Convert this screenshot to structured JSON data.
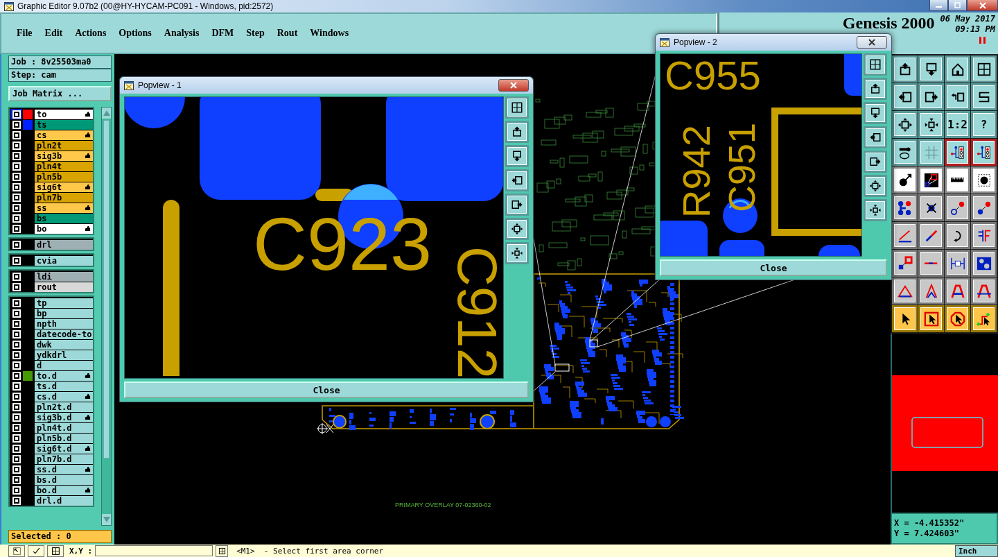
{
  "window": {
    "title": "Graphic Editor 9.07b2 (00@HY-HYCAM-PC091 - Windows, pid:2572)"
  },
  "menu": [
    {
      "label": "File"
    },
    {
      "label": "Edit"
    },
    {
      "label": "Actions"
    },
    {
      "label": "Options"
    },
    {
      "label": "Analysis"
    },
    {
      "label": "DFM"
    },
    {
      "label": "Step"
    },
    {
      "label": "Rout"
    },
    {
      "label": "Windows"
    }
  ],
  "brand": {
    "product": "Genesis 2000",
    "date": "06 May 2017",
    "time": "09:13 PM"
  },
  "job": {
    "job": "Job : 8v25503ma0",
    "step": "Step: cam",
    "matrix_button": "Job Matrix ..."
  },
  "layer_groups": [
    {
      "layers": [
        {
          "name": "to",
          "kind": "silk",
          "color": "#ff0000",
          "marked": true,
          "affected": true
        },
        {
          "name": "ts",
          "kind": "mask",
          "color": "#0022ff",
          "marked": false,
          "affected": false
        },
        {
          "name": "cs",
          "kind": "signal",
          "marked": true,
          "affected": false
        },
        {
          "name": "pln2t",
          "kind": "plane",
          "marked": false,
          "affected": false
        },
        {
          "name": "sig3b",
          "kind": "signal",
          "marked": true,
          "affected": false
        },
        {
          "name": "pln4t",
          "kind": "plane",
          "marked": false,
          "affected": false
        },
        {
          "name": "pln5b",
          "kind": "plane",
          "marked": false,
          "affected": false
        },
        {
          "name": "sig6t",
          "kind": "signal",
          "marked": true,
          "affected": false
        },
        {
          "name": "pln7b",
          "kind": "plane",
          "marked": false,
          "affected": false
        },
        {
          "name": "ss",
          "kind": "signal",
          "marked": true,
          "affected": false
        },
        {
          "name": "bs",
          "kind": "mask",
          "marked": false,
          "affected": false
        },
        {
          "name": "bo",
          "kind": "silk",
          "marked": true,
          "affected": false
        }
      ]
    },
    {
      "layers": [
        {
          "name": "drl",
          "kind": "drill",
          "marked": false,
          "affected": false
        }
      ]
    },
    {
      "layers": [
        {
          "name": "cvia",
          "kind": "misc",
          "marked": false,
          "affected": false
        }
      ]
    },
    {
      "layers": [
        {
          "name": "ldi",
          "kind": "drill",
          "marked": false,
          "affected": false
        },
        {
          "name": "rout",
          "kind": "rout",
          "marked": false,
          "affected": false
        }
      ]
    },
    {
      "layers": [
        {
          "name": "tp",
          "kind": "misc",
          "marked": false,
          "affected": false
        },
        {
          "name": "bp",
          "kind": "misc",
          "marked": false,
          "affected": false
        },
        {
          "name": "npth",
          "kind": "misc",
          "marked": false,
          "affected": false
        },
        {
          "name": "datecode-to",
          "kind": "misc",
          "marked": false,
          "affected": false
        },
        {
          "name": "dwk",
          "kind": "misc",
          "marked": false,
          "affected": false
        },
        {
          "name": "ydkdrl",
          "kind": "misc",
          "marked": false,
          "affected": false
        },
        {
          "name": "d",
          "kind": "misc",
          "marked": false,
          "affected": false
        },
        {
          "name": "to.d",
          "kind": "misc",
          "color": "#449900",
          "marked": true,
          "affected": false
        },
        {
          "name": "ts.d",
          "kind": "misc",
          "marked": false,
          "affected": false
        },
        {
          "name": "cs.d",
          "kind": "misc",
          "marked": true,
          "affected": false
        },
        {
          "name": "pln2t.d",
          "kind": "misc",
          "marked": false,
          "affected": false
        },
        {
          "name": "sig3b.d",
          "kind": "misc",
          "marked": true,
          "affected": false
        },
        {
          "name": "pln4t.d",
          "kind": "misc",
          "marked": false,
          "affected": false
        },
        {
          "name": "pln5b.d",
          "kind": "misc",
          "marked": false,
          "affected": false
        },
        {
          "name": "sig6t.d",
          "kind": "misc",
          "marked": true,
          "affected": false
        },
        {
          "name": "pln7b.d",
          "kind": "misc",
          "marked": false,
          "affected": false
        },
        {
          "name": "ss.d",
          "kind": "misc",
          "marked": true,
          "affected": false
        },
        {
          "name": "bs.d",
          "kind": "misc",
          "marked": false,
          "affected": false
        },
        {
          "name": "bo.d",
          "kind": "misc",
          "marked": true,
          "affected": false
        },
        {
          "name": "drl.d",
          "kind": "misc",
          "marked": false,
          "affected": false
        }
      ]
    }
  ],
  "selected_count": "Selected : 0",
  "canvas": {
    "overlay_label": "PRIMARY OVERLAY 07-02360-02"
  },
  "popviews": [
    {
      "title": "Popview - 1",
      "active": true,
      "labels": [
        {
          "text": "C923",
          "kind": "horizontal"
        },
        {
          "text": "C912",
          "kind": "down"
        }
      ],
      "close": "Close"
    },
    {
      "title": "Popview - 2",
      "active": false,
      "labels": [
        {
          "text": "C955",
          "kind": "horizontal"
        },
        {
          "text": "R942",
          "kind": "up"
        },
        {
          "text": "C951",
          "kind": "up"
        }
      ],
      "close": "Close"
    }
  ],
  "tools": [
    {
      "kind": "export-up"
    },
    {
      "kind": "export-down"
    },
    {
      "kind": "home"
    },
    {
      "kind": "panes"
    },
    {
      "kind": "box-left"
    },
    {
      "kind": "box-right"
    },
    {
      "kind": "undo"
    },
    {
      "kind": "zigzag"
    },
    {
      "kind": "fit"
    },
    {
      "kind": "center"
    },
    {
      "kind": "ratio",
      "label": "1:2"
    },
    {
      "kind": "help",
      "label": "?"
    },
    {
      "kind": "settings"
    },
    {
      "kind": "grid"
    },
    {
      "kind": "circuit"
    },
    {
      "kind": "circuit"
    },
    {
      "kind": "pad-arrow"
    },
    {
      "kind": "snap"
    },
    {
      "kind": "ruler"
    },
    {
      "kind": "pad"
    },
    {
      "kind": "nodes"
    },
    {
      "kind": "cross"
    },
    {
      "kind": "pad-link"
    },
    {
      "kind": "pad-link-blue"
    },
    {
      "kind": "slash"
    },
    {
      "kind": "slash-blue"
    },
    {
      "kind": "curve"
    },
    {
      "kind": "split"
    },
    {
      "kind": "pad-box"
    },
    {
      "kind": "line"
    },
    {
      "kind": "measure"
    },
    {
      "kind": "blobs"
    },
    {
      "kind": "triangle"
    },
    {
      "kind": "peak"
    },
    {
      "kind": "arch"
    },
    {
      "kind": "arch-cross"
    },
    {
      "kind": "pointer"
    },
    {
      "kind": "pointer-box"
    },
    {
      "kind": "pointer-oct"
    },
    {
      "kind": "pointer-route"
    }
  ],
  "coords": {
    "x": "X = -4.415352\"",
    "y": "Y = 7.424603\""
  },
  "status": {
    "xy_label": "X,Y :",
    "prompt": "<M1>  - Select first area corner",
    "units": "Inch"
  }
}
